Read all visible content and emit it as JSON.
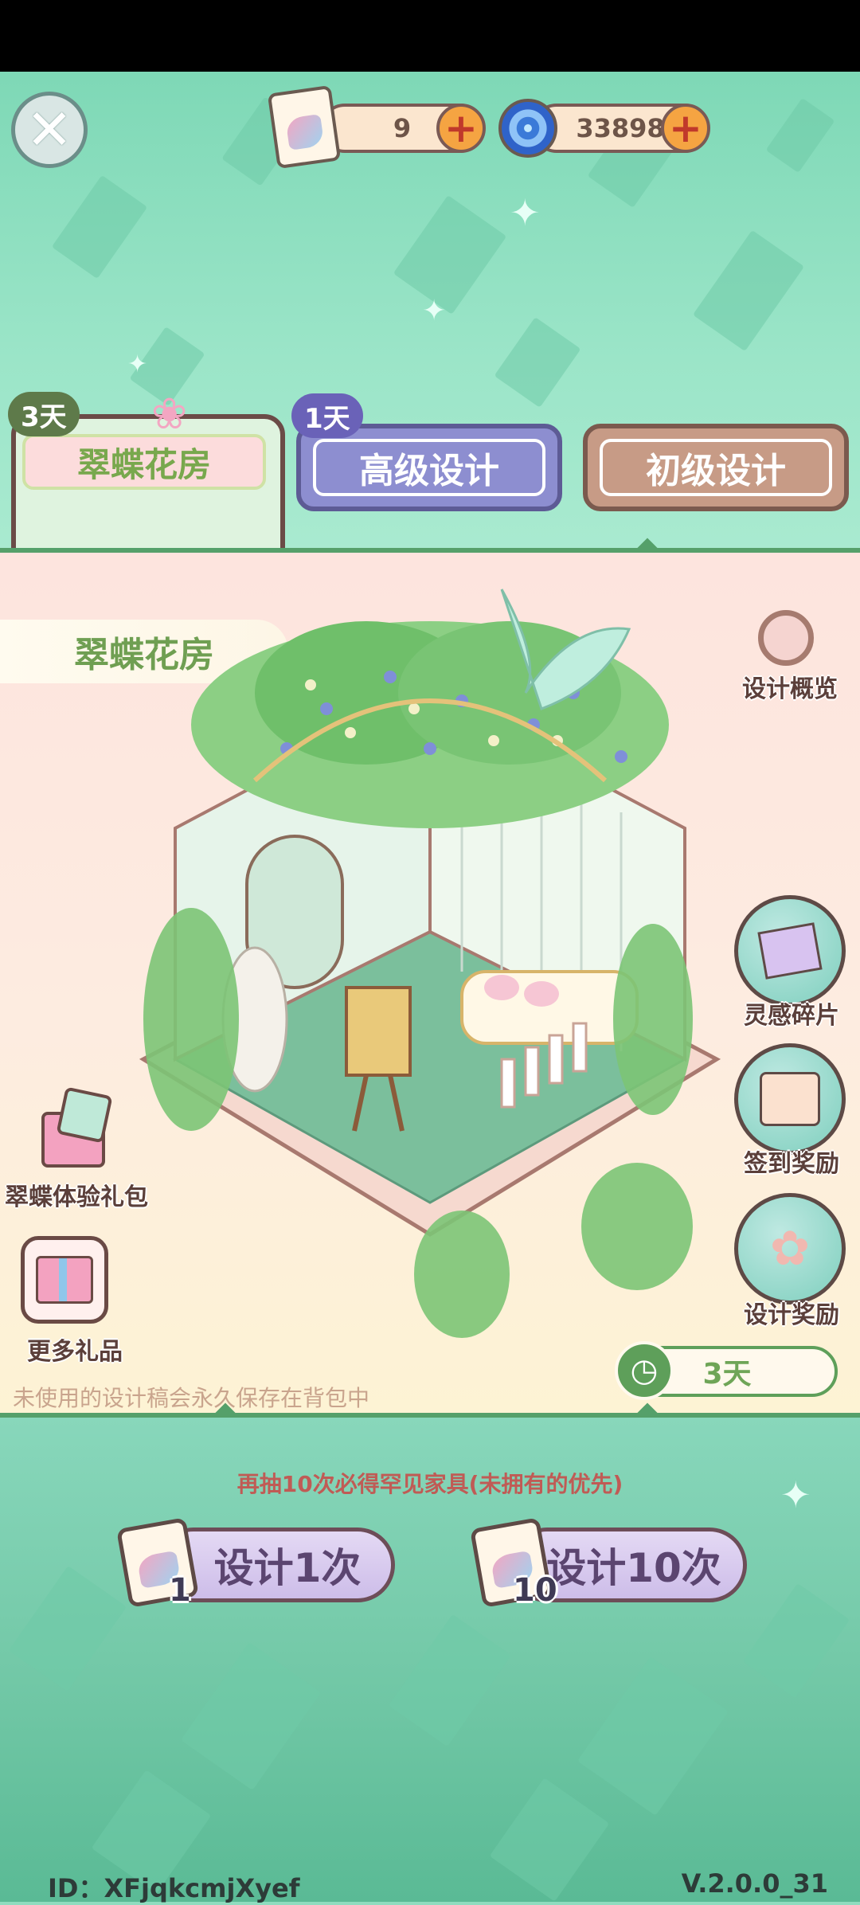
{
  "header": {
    "close_icon": "close-icon",
    "ticket_count": "9",
    "gem_count": "33898"
  },
  "tabs": [
    {
      "label": "翠蝶花房",
      "badge": "3天",
      "active": true
    },
    {
      "label": "高级设计",
      "badge": "1天",
      "active": false
    },
    {
      "label": "初级设计",
      "badge": "",
      "active": false
    }
  ],
  "main": {
    "room_name": "翠蝶花房",
    "overview_label": "设计概览",
    "inspiration_label": "灵感碎片",
    "checkin_label": "签到奖励",
    "design_reward_label": "设计奖励",
    "trial_pack_label": "翠蝶体验礼包",
    "more_gifts_label": "更多礼品",
    "timer_text": "3天",
    "note": "未使用的设计稿会永久保存在背包中"
  },
  "draw": {
    "pity_text": "再抽10次必得罕见家具(未拥有的优先)",
    "single_label": "设计1次",
    "single_cost": "1",
    "ten_label": "设计10次",
    "ten_cost": "10"
  },
  "footer": {
    "id_text": "ID：XFjqkcmjXyef",
    "version": "V.2.0.0_31"
  },
  "colors": {
    "accent_green": "#55a06a",
    "tab_purple": "#8d8ed0",
    "tab_brown": "#c79b86"
  }
}
